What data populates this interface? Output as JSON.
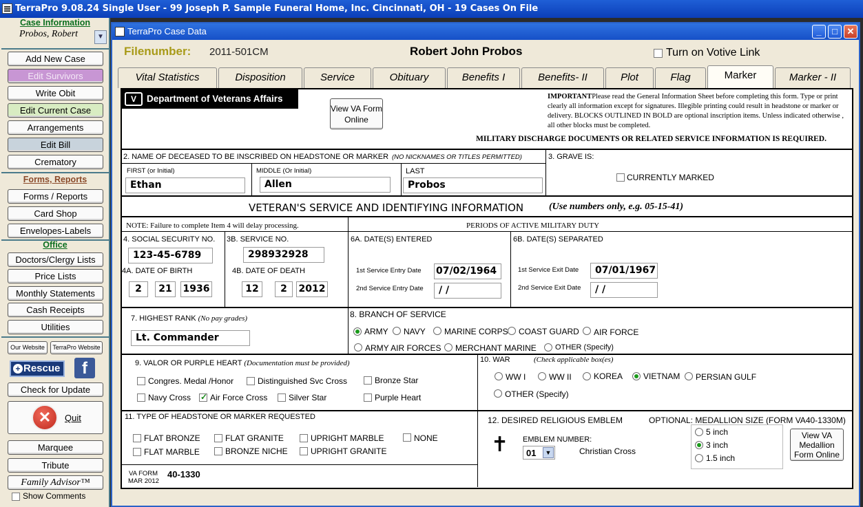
{
  "titlebar": {
    "text": "TerraPro 9.08.24 Single User - 99 Joseph P. Sample Funeral Home, Inc. Cincinnati, OH -     19 Cases On File"
  },
  "sidebar": {
    "case_info_head": "Case Information",
    "case_name": "Probos, Robert",
    "buttons_case": [
      "Add New Case",
      "Edit Survivors",
      "Write Obit",
      "Edit Current Case",
      "Arrangements",
      "Edit Bill",
      "Crematory"
    ],
    "forms_head": "Forms, Reports",
    "buttons_forms": [
      "Forms / Reports",
      "Card Shop",
      "Envelopes-Labels"
    ],
    "office_head": "Office",
    "buttons_office": [
      "Doctors/Clergy Lists",
      "Price Lists",
      "Monthly Statements",
      "Cash Receipts",
      "Utilities"
    ],
    "our_website": "Our Website",
    "terrapro_website": "TerraPro Website",
    "rescue": "Rescue",
    "check_update": "Check for Update",
    "quit": "Quit",
    "marquee": "Marquee",
    "tribute": "Tribute",
    "family_advisor": "Family Advisor™",
    "show_comments": "Show Comments"
  },
  "window": {
    "title": "TerraPro Case Data",
    "filenumber_label": "Filenumber:",
    "filenumber": "2011-501CM",
    "deceased": "Robert John Probos",
    "votive": "Turn on Votive Link",
    "tabs": [
      "Vital Statistics",
      "Disposition",
      "Service",
      "Obituary",
      "Benefits I",
      "Benefits- II",
      "Plot",
      "Flag",
      "Marker",
      "Marker - II"
    ],
    "active_tab": "Marker"
  },
  "form": {
    "va_logo": "Department of Veterans Affairs",
    "view_va": "View VA Form Online",
    "important_bold": "IMPORTANT",
    "important_text": "Please read the General Information Sheet before completing this form. Type or print clearly all information except for signatures.  Illegible printing could result in headstone or marker or delivery.  BLOCKS OUTLINED IN BOLD are optional inscription items.  Unless indicated otherwise , all other blocks must be completed.",
    "military_note": "MILITARY  DISCHARGE DOCUMENTS OR RELATED SERVICE INFORMATION IS REQUIRED.",
    "name_head": "2. NAME OF DECEASED TO BE INSCRIBED ON HEADSTONE OR MARKER",
    "name_note": "(NO NICKNAMES OR TITLES PERMITTED)",
    "first_label": "FIRST (or Initial)",
    "first": "Ethan",
    "middle_label": "MIDDLE (Or Initial)",
    "middle": "Allen",
    "last_label": "LAST",
    "last": "Probos",
    "grave_head": "3. GRAVE IS:",
    "currently_marked": "CURRENTLY MARKED",
    "vet_head": "VETERAN'S SERVICE AND IDENTIFYING INFORMATION",
    "vet_note": "(Use numbers only, e.g. 05-15-41)",
    "note_item4": "NOTE: Failure to complete Item 4 will delay processing.",
    "periods_head": "PERIODS OF ACTIVE MILITARY DUTY",
    "ssn_label": "4. SOCIAL SECURITY NO.",
    "ssn": "123-45-6789",
    "service_no_label": "3B. SERVICE NO.",
    "service_no": "298932928",
    "dob_label": "4A. DATE OF BIRTH",
    "dob": [
      "2",
      "21",
      "1936"
    ],
    "dod_label": "4B. DATE OF DEATH",
    "dod": [
      "12",
      "2",
      "2012"
    ],
    "entered_head": "6A. DATE(S) ENTERED",
    "entry1_label": "1st Service Entry Date",
    "entry1": "07/02/1964",
    "entry2_label": "2nd Service Entry Date",
    "entry2": " /  /",
    "separated_head": "6B. DATE(S) SEPARATED",
    "exit1_label": "1st Service Exit Date",
    "exit1": "07/01/1967",
    "exit2_label": "2nd Service Exit Date",
    "exit2": " /  /",
    "rank_head": "7. HIGHEST RANK",
    "rank_note": "(No pay grades)",
    "rank": "Lt. Commander",
    "branch_head": "8. BRANCH OF SERVICE",
    "branches_row1": [
      "ARMY",
      "NAVY",
      "MARINE CORPS",
      "COAST GUARD",
      "AIR FORCE"
    ],
    "branches_row2": [
      "ARMY AIR FORCES",
      "MERCHANT MARINE",
      "OTHER (Specify)"
    ],
    "branch_selected": "ARMY",
    "valor_head": "9. VALOR OR PURPLE HEART",
    "valor_note": "(Documentation must be provided)",
    "valor_items": [
      "Congres. Medal /Honor",
      "Distinguished Svc Cross",
      "Bronze Star",
      "Navy Cross",
      "Air Force Cross",
      "Silver Star",
      "Purple Heart"
    ],
    "valor_checked": "Air Force Cross",
    "war_head": "10. WAR",
    "war_note": "(Check applicable box(es)",
    "wars": [
      "WW I",
      "WW II",
      "KOREA",
      "VIETNAM",
      "PERSIAN GULF",
      "OTHER (Specify)"
    ],
    "war_selected": "VIETNAM",
    "type_head": "11. TYPE OF HEADSTONE OR MARKER REQUESTED",
    "types": [
      "FLAT BRONZE",
      "FLAT GRANITE",
      "UPRIGHT MARBLE",
      "NONE",
      "FLAT MARBLE",
      "BRONZE NICHE",
      "UPRIGHT GRANITE"
    ],
    "emblem_head": "12. DESIRED RELIGIOUS EMBLEM",
    "emblem_number_label": "EMBLEM NUMBER:",
    "emblem_number": "01",
    "emblem_name": "Christian Cross",
    "medallion_head": "OPTIONAL: MEDALLION SIZE (FORM VA40-1330M)",
    "medallion_sizes": [
      "5 inch",
      "3 inch",
      "1.5 inch"
    ],
    "medallion_selected": "3 inch",
    "view_medallion": "View VA Medallion Form Online",
    "va_form_label": "VA FORM",
    "va_form_date": "MAR 2012",
    "va_form_no": "40-1330"
  }
}
